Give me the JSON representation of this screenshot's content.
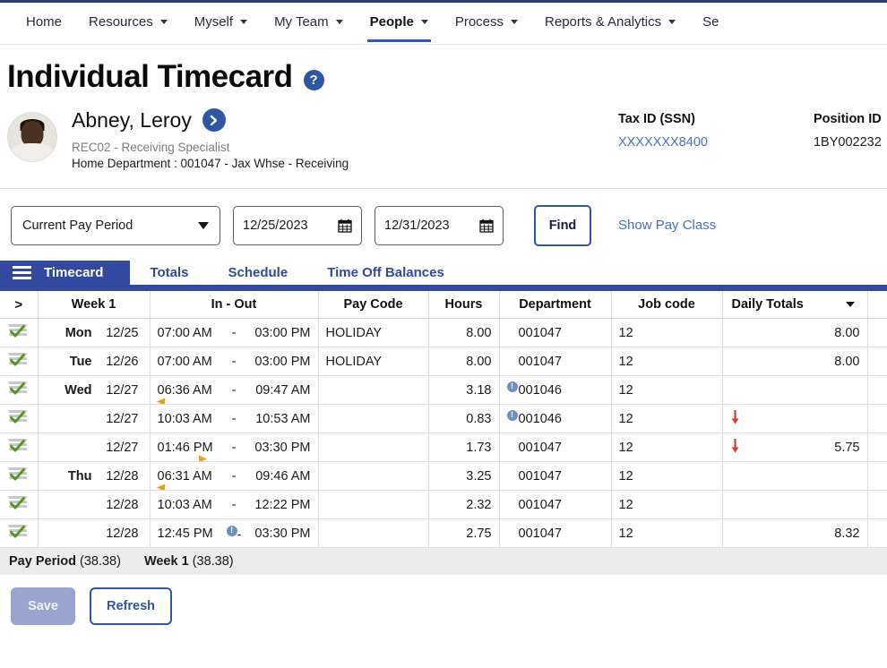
{
  "topnav": {
    "items": [
      {
        "label": "Home",
        "has_caret": false,
        "active": false
      },
      {
        "label": "Resources",
        "has_caret": true,
        "active": false
      },
      {
        "label": "Myself",
        "has_caret": true,
        "active": false
      },
      {
        "label": "My Team",
        "has_caret": true,
        "active": false
      },
      {
        "label": "People",
        "has_caret": true,
        "active": true
      },
      {
        "label": "Process",
        "has_caret": true,
        "active": false
      },
      {
        "label": "Reports & Analytics",
        "has_caret": true,
        "active": false
      },
      {
        "label": "Se",
        "has_caret": false,
        "active": false
      }
    ]
  },
  "page": {
    "title": "Individual Timecard",
    "help_label": "?"
  },
  "employee": {
    "name": "Abney, Leroy",
    "role": "REC02 - Receiving Specialist",
    "home_department": "Home Department : 001047 - Jax Whse - Receiving",
    "tax_id_label": "Tax ID (SSN)",
    "tax_id_value": "XXXXXXX8400",
    "position_id_label": "Position ID",
    "position_id_value": "1BY002232"
  },
  "filters": {
    "period": "Current Pay Period",
    "start_date": "12/25/2023",
    "end_date": "12/31/2023",
    "find_label": "Find",
    "show_pay_class_label": "Show Pay Class"
  },
  "section_tabs": [
    {
      "label": "Timecard",
      "active": true
    },
    {
      "label": "Totals",
      "active": false
    },
    {
      "label": "Schedule",
      "active": false
    },
    {
      "label": "Time Off Balances",
      "active": false
    }
  ],
  "grid": {
    "columns": {
      "expand": ">",
      "week": "Week 1",
      "in_out": "In - Out",
      "pay_code": "Pay Code",
      "hours": "Hours",
      "department": "Department",
      "job_code": "Job code",
      "daily_totals": "Daily Totals"
    },
    "rows": [
      {
        "day": "Mon",
        "date": "12/25",
        "time_in": "07:00 AM",
        "dash": "-",
        "time_out": "03:00 PM",
        "in_arrow": "",
        "in_info": false,
        "out_info": false,
        "pay_code": "HOLIDAY",
        "hours": "8.00",
        "department": "001047",
        "dept_info": false,
        "job_code": "12",
        "daily_total": "8.00",
        "total_flag": false
      },
      {
        "day": "Tue",
        "date": "12/26",
        "time_in": "07:00 AM",
        "dash": "-",
        "time_out": "03:00 PM",
        "in_arrow": "",
        "in_info": false,
        "out_info": false,
        "pay_code": "HOLIDAY",
        "hours": "8.00",
        "department": "001047",
        "dept_info": false,
        "job_code": "12",
        "daily_total": "8.00",
        "total_flag": false
      },
      {
        "day": "Wed",
        "date": "12/27",
        "time_in": "06:36 AM",
        "dash": "-",
        "time_out": "09:47 AM",
        "in_arrow": "left",
        "in_info": false,
        "out_info": false,
        "pay_code": "",
        "hours": "3.18",
        "department": "001046",
        "dept_info": true,
        "job_code": "12",
        "daily_total": "",
        "total_flag": false
      },
      {
        "day": "",
        "date": "12/27",
        "time_in": "10:03 AM",
        "dash": "-",
        "time_out": "10:53 AM",
        "in_arrow": "",
        "in_info": false,
        "out_info": false,
        "pay_code": "",
        "hours": "0.83",
        "department": "001046",
        "dept_info": true,
        "job_code": "12",
        "daily_total": "",
        "total_flag": true
      },
      {
        "day": "",
        "date": "12/27",
        "time_in": "01:46 PM",
        "dash": "-",
        "time_out": "03:30 PM",
        "in_arrow": "right",
        "in_info": false,
        "out_info": false,
        "pay_code": "",
        "hours": "1.73",
        "department": "001047",
        "dept_info": false,
        "job_code": "12",
        "daily_total": "5.75",
        "total_flag": true
      },
      {
        "day": "Thu",
        "date": "12/28",
        "time_in": "06:31 AM",
        "dash": "-",
        "time_out": "09:46 AM",
        "in_arrow": "left",
        "in_info": false,
        "out_info": false,
        "pay_code": "",
        "hours": "3.25",
        "department": "001047",
        "dept_info": false,
        "job_code": "12",
        "daily_total": "",
        "total_flag": false
      },
      {
        "day": "",
        "date": "12/28",
        "time_in": "10:03 AM",
        "dash": "-",
        "time_out": "12:22 PM",
        "in_arrow": "",
        "in_info": false,
        "out_info": false,
        "pay_code": "",
        "hours": "2.32",
        "department": "001047",
        "dept_info": false,
        "job_code": "12",
        "daily_total": "",
        "total_flag": false
      },
      {
        "day": "",
        "date": "12/28",
        "time_in": "12:45 PM",
        "dash": "-",
        "time_out": "03:30 PM",
        "in_arrow": "",
        "in_info": true,
        "out_info": false,
        "pay_code": "",
        "hours": "2.75",
        "department": "001047",
        "dept_info": false,
        "job_code": "12",
        "daily_total": "8.32",
        "total_flag": false
      }
    ]
  },
  "totals_bar": {
    "pay_period_label": "Pay Period",
    "pay_period_value": "(38.38)",
    "week_label": "Week 1",
    "week_value": "(38.38)"
  },
  "actions": {
    "save_label": "Save",
    "refresh_label": "Refresh"
  },
  "colors": {
    "brand_blue": "#33499f",
    "link_blue": "#4a6fc0",
    "accent_orange": "#e8a317",
    "flag_red": "#e03a2f",
    "info_blue": "#6e8fc4"
  }
}
